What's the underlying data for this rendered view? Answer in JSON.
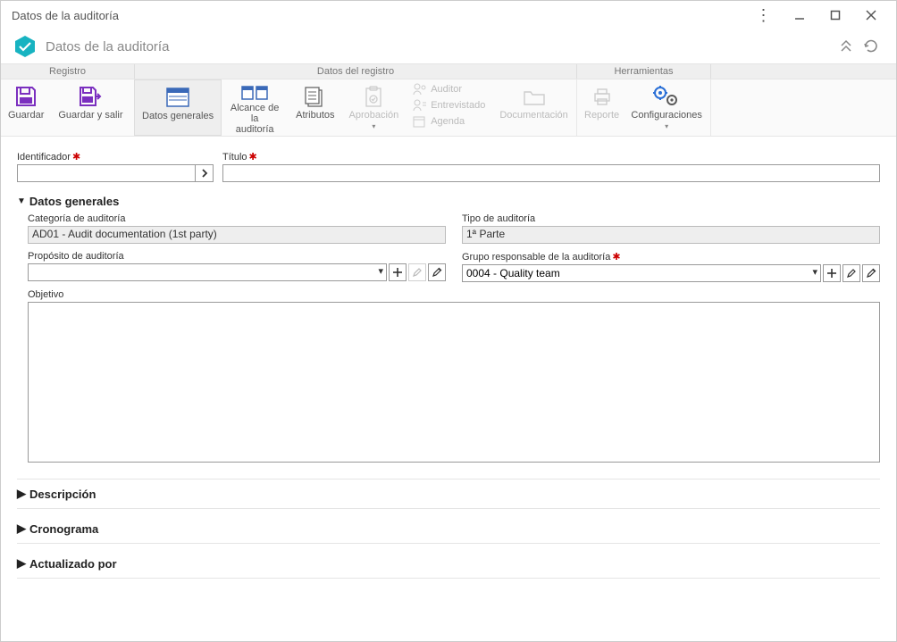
{
  "window": {
    "title": "Datos de la auditoría"
  },
  "header": {
    "title": "Datos de la auditoría"
  },
  "ribbon_groups": {
    "registro": "Registro",
    "datos_registro": "Datos del registro",
    "herramientas": "Herramientas"
  },
  "ribbon": {
    "guardar": "Guardar",
    "guardar_salir": "Guardar y salir",
    "datos_generales": "Datos generales",
    "alcance": "Alcance de la\nauditoría",
    "atributos": "Atributos",
    "aprobacion": "Aprobación",
    "auditor": "Auditor",
    "entrevistado": "Entrevistado",
    "agenda": "Agenda",
    "documentacion": "Documentación",
    "reporte": "Reporte",
    "configuraciones": "Configuraciones"
  },
  "form": {
    "identificador_label": "Identificador",
    "identificador_value": "",
    "titulo_label": "Título",
    "titulo_value": ""
  },
  "sections": {
    "datos_generales": "Datos generales",
    "descripcion": "Descripción",
    "cronograma": "Cronograma",
    "actualizado_por": "Actualizado por"
  },
  "general": {
    "categoria_label": "Categoría de auditoría",
    "categoria_value": "AD01 - Audit documentation (1st party)",
    "tipo_label": "Tipo de auditoría",
    "tipo_value": "1ª Parte",
    "proposito_label": "Propósito de auditoría",
    "proposito_value": "",
    "grupo_label": "Grupo responsable de la auditoría",
    "grupo_value": "0004 - Quality team",
    "objetivo_label": "Objetivo",
    "objetivo_value": ""
  },
  "icons": {
    "hexagon_color": "#17b3c1",
    "save_color": "#7b2fbf",
    "gear1": "#2a6fd6",
    "gear2": "#5a5a5a"
  }
}
